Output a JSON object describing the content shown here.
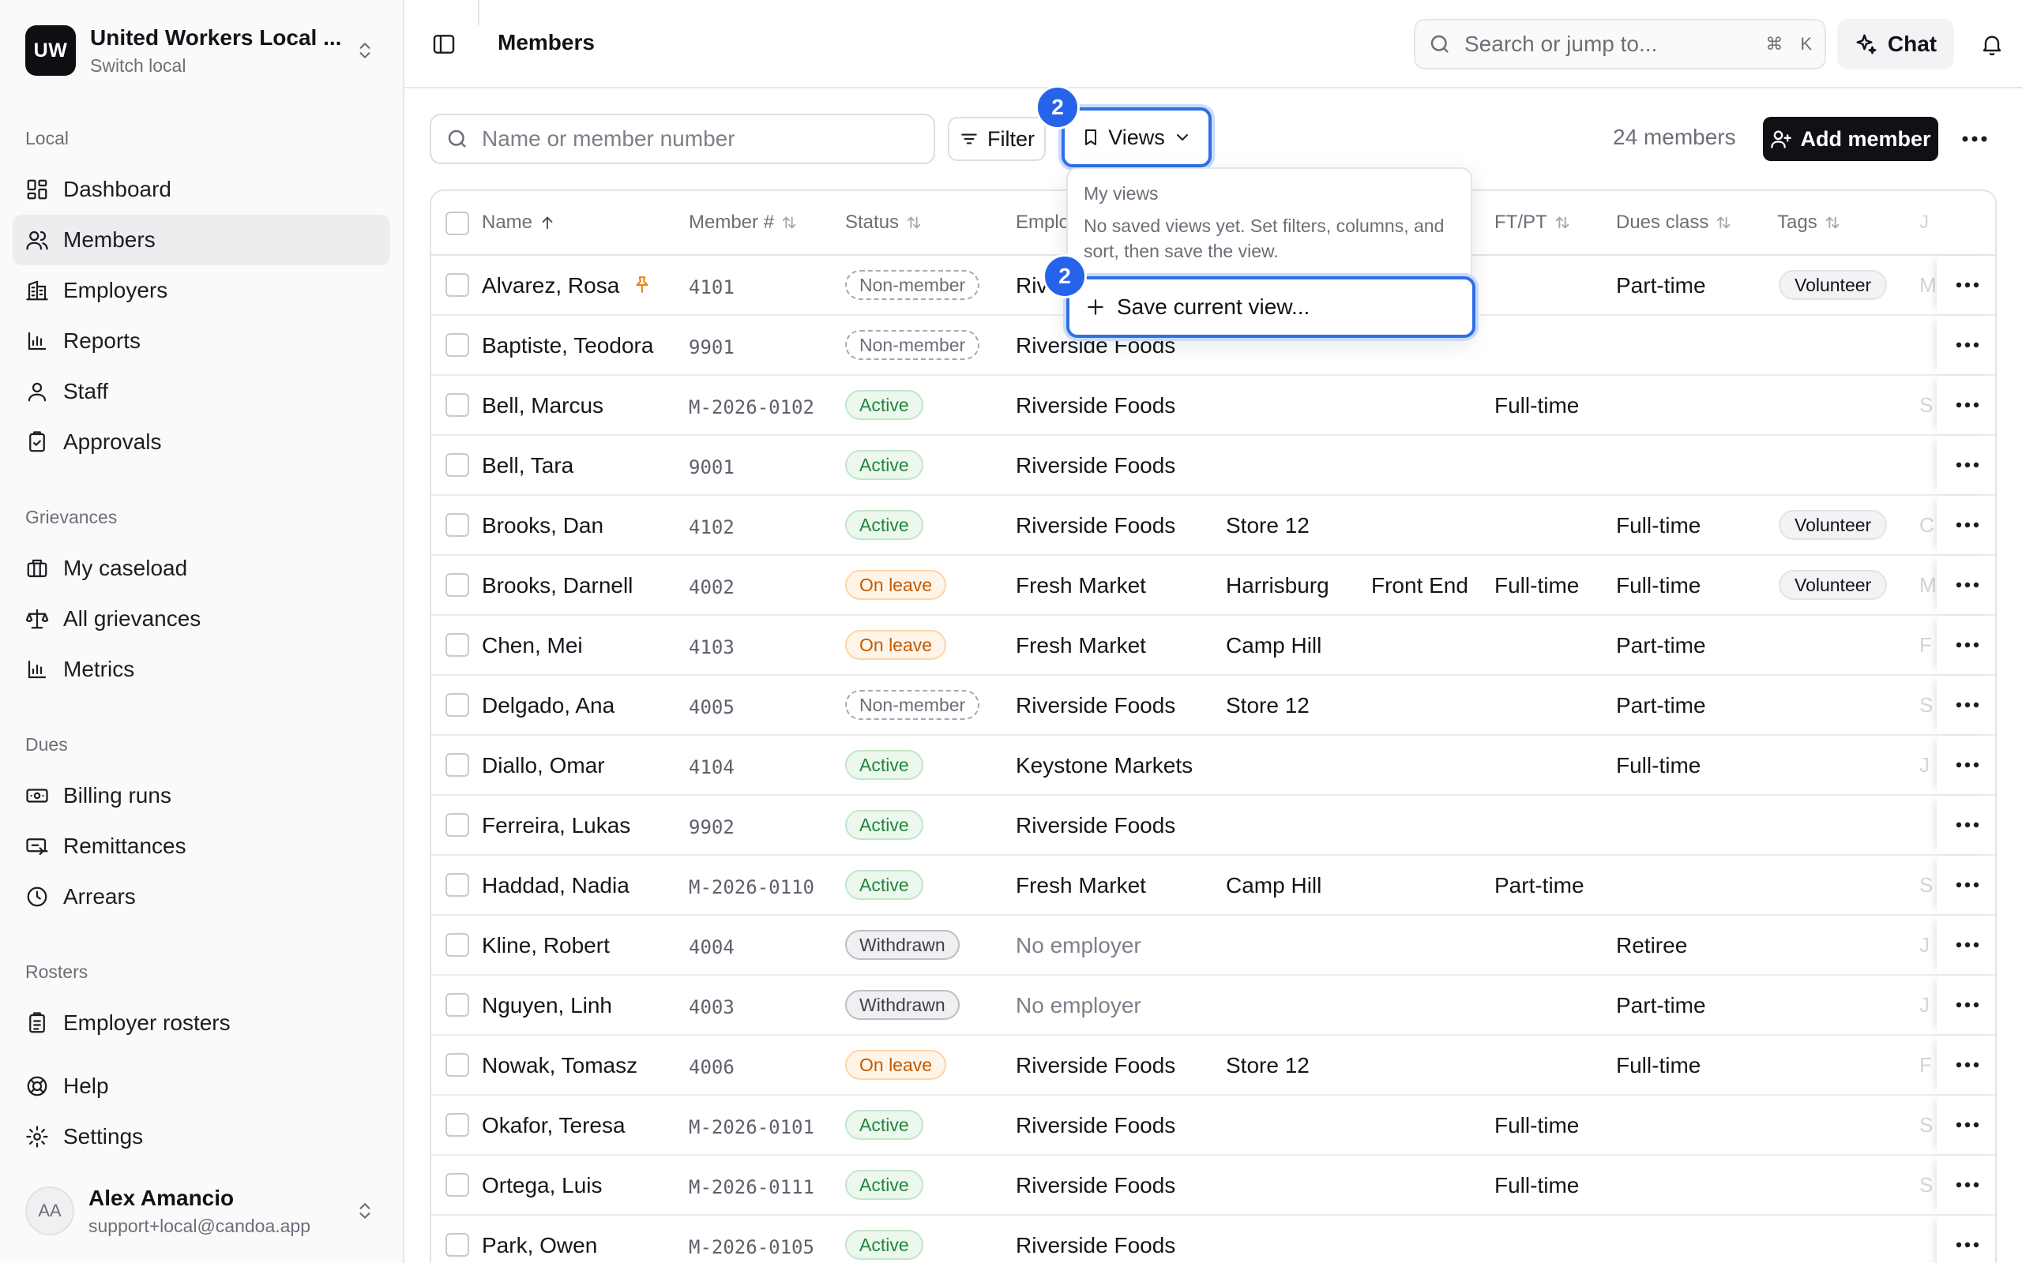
{
  "org": {
    "initials": "UW",
    "name": "United Workers Local ...",
    "sub": "Switch local"
  },
  "sidebar": {
    "sections": {
      "local": "Local",
      "grievances": "Grievances",
      "dues": "Dues",
      "rosters": "Rosters"
    },
    "local_items": [
      "Dashboard",
      "Members",
      "Employers",
      "Reports",
      "Staff",
      "Approvals"
    ],
    "grievance_items": [
      "My caseload",
      "All grievances",
      "Metrics"
    ],
    "dues_items": [
      "Billing runs",
      "Remittances",
      "Arrears"
    ],
    "roster_items": [
      "Employer rosters"
    ],
    "footer_items": [
      "Help",
      "Settings"
    ]
  },
  "user": {
    "initials": "AA",
    "name": "Alex Amancio",
    "email": "support+local@candoa.app"
  },
  "header": {
    "title": "Members",
    "search_placeholder": "Search or jump to...",
    "shortcut_cmd": "⌘",
    "shortcut_key": "K",
    "chat_label": "Chat"
  },
  "toolbar": {
    "search_placeholder": "Name or member number",
    "filter_label": "Filter",
    "views_label": "Views",
    "count_text": "24 members",
    "add_label": "Add member",
    "step_badge": "2"
  },
  "views_menu": {
    "title": "My views",
    "empty_text": "No saved views yet. Set filters, columns, and sort, then save the view.",
    "save_label": "Save current view...",
    "step_badge": "2"
  },
  "table": {
    "headers": {
      "name": "Name",
      "member_no": "Member #",
      "status": "Status",
      "employer": "Emplo",
      "ftpt": "FT/PT",
      "dues": "Dues class",
      "tags": "Tags",
      "cut": "J"
    },
    "rows": [
      {
        "name": "Alvarez, Rosa",
        "no": "4101",
        "status": "Non-member",
        "kind": "non",
        "employer": "Riv",
        "loc": "",
        "dept": "",
        "ftpt": "",
        "dues": "Part-time",
        "tag": "Volunteer",
        "cut": "M",
        "pinned": true
      },
      {
        "name": "Baptiste, Teodora",
        "no": "9901",
        "status": "Non-member",
        "kind": "non",
        "employer": "Riverside Foods",
        "loc": "",
        "dept": "",
        "ftpt": "",
        "dues": "",
        "tag": "",
        "cut": ""
      },
      {
        "name": "Bell, Marcus",
        "no": "M-2026-0102",
        "status": "Active",
        "kind": "active",
        "employer": "Riverside Foods",
        "loc": "",
        "dept": "",
        "ftpt": "Full-time",
        "dues": "",
        "tag": "",
        "cut": "S"
      },
      {
        "name": "Bell, Tara",
        "no": "9001",
        "status": "Active",
        "kind": "active",
        "employer": "Riverside Foods",
        "loc": "",
        "dept": "",
        "ftpt": "",
        "dues": "",
        "tag": "",
        "cut": ""
      },
      {
        "name": "Brooks, Dan",
        "no": "4102",
        "status": "Active",
        "kind": "active",
        "employer": "Riverside Foods",
        "loc": "Store 12",
        "dept": "",
        "ftpt": "",
        "dues": "Full-time",
        "tag": "Volunteer",
        "cut": "C"
      },
      {
        "name": "Brooks, Darnell",
        "no": "4002",
        "status": "On leave",
        "kind": "leave",
        "employer": "Fresh Market",
        "loc": "Harrisburg",
        "dept": "Front End",
        "ftpt": "Full-time",
        "dues": "Full-time",
        "tag": "Volunteer",
        "cut": "M"
      },
      {
        "name": "Chen, Mei",
        "no": "4103",
        "status": "On leave",
        "kind": "leave",
        "employer": "Fresh Market",
        "loc": "Camp Hill",
        "dept": "",
        "ftpt": "",
        "dues": "Part-time",
        "tag": "",
        "cut": "F"
      },
      {
        "name": "Delgado, Ana",
        "no": "4005",
        "status": "Non-member",
        "kind": "non",
        "employer": "Riverside Foods",
        "loc": "Store 12",
        "dept": "",
        "ftpt": "",
        "dues": "Part-time",
        "tag": "",
        "cut": "S"
      },
      {
        "name": "Diallo, Omar",
        "no": "4104",
        "status": "Active",
        "kind": "active",
        "employer": "Keystone Markets",
        "loc": "",
        "dept": "",
        "ftpt": "",
        "dues": "Full-time",
        "tag": "",
        "cut": "J"
      },
      {
        "name": "Ferreira, Lukas",
        "no": "9902",
        "status": "Active",
        "kind": "active",
        "employer": "Riverside Foods",
        "loc": "",
        "dept": "",
        "ftpt": "",
        "dues": "",
        "tag": "",
        "cut": ""
      },
      {
        "name": "Haddad, Nadia",
        "no": "M-2026-0110",
        "status": "Active",
        "kind": "active",
        "employer": "Fresh Market",
        "loc": "Camp Hill",
        "dept": "",
        "ftpt": "Part-time",
        "dues": "",
        "tag": "",
        "cut": "S"
      },
      {
        "name": "Kline, Robert",
        "no": "4004",
        "status": "Withdrawn",
        "kind": "withdrawn",
        "employer": "No employer",
        "muted": true,
        "loc": "",
        "dept": "",
        "ftpt": "",
        "dues": "Retiree",
        "tag": "",
        "cut": "J"
      },
      {
        "name": "Nguyen, Linh",
        "no": "4003",
        "status": "Withdrawn",
        "kind": "withdrawn",
        "employer": "No employer",
        "muted": true,
        "loc": "",
        "dept": "",
        "ftpt": "",
        "dues": "Part-time",
        "tag": "",
        "cut": "J"
      },
      {
        "name": "Nowak, Tomasz",
        "no": "4006",
        "status": "On leave",
        "kind": "leave",
        "employer": "Riverside Foods",
        "loc": "Store 12",
        "dept": "",
        "ftpt": "",
        "dues": "Full-time",
        "tag": "",
        "cut": "F"
      },
      {
        "name": "Okafor, Teresa",
        "no": "M-2026-0101",
        "status": "Active",
        "kind": "active",
        "employer": "Riverside Foods",
        "loc": "",
        "dept": "",
        "ftpt": "Full-time",
        "dues": "",
        "tag": "",
        "cut": "S"
      },
      {
        "name": "Ortega, Luis",
        "no": "M-2026-0111",
        "status": "Active",
        "kind": "active",
        "employer": "Riverside Foods",
        "loc": "",
        "dept": "",
        "ftpt": "Full-time",
        "dues": "",
        "tag": "",
        "cut": "S"
      },
      {
        "name": "Park, Owen",
        "no": "M-2026-0105",
        "status": "Active",
        "kind": "active",
        "employer": "Riverside Foods",
        "loc": "",
        "dept": "",
        "ftpt": "",
        "dues": "",
        "tag": "",
        "cut": ""
      }
    ]
  }
}
